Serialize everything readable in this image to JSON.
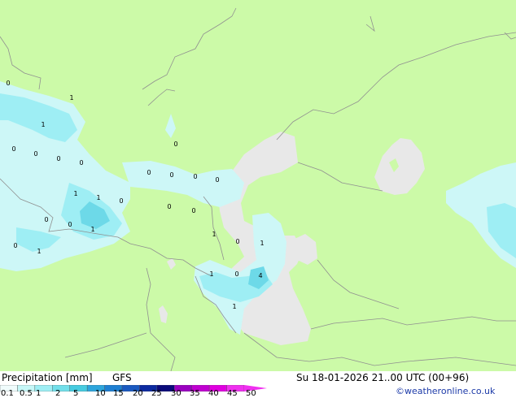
{
  "footer": {
    "title": "Precipitation [mm]",
    "model": "GFS",
    "datetime": "Su 18-01-2026 21..00 UTC (00+96)",
    "credit": "©weatheronline.co.uk"
  },
  "legend": {
    "ticks": [
      "0.1",
      "0.5",
      "1",
      "2",
      "5",
      "10",
      "15",
      "20",
      "25",
      "30",
      "35",
      "40",
      "45",
      "50"
    ],
    "colors": [
      "#f0fcfc",
      "#c6f7f7",
      "#9eeef4",
      "#72dfea",
      "#46cbe0",
      "#2da5dc",
      "#1e7fd2",
      "#1a59c0",
      "#0c2aa0",
      "#0a0a7a",
      "#9a00c0",
      "#c000d0",
      "#e000e0",
      "#f030f0"
    ]
  },
  "map": {
    "land_color": "#ccfaa8",
    "sea_color": "#e8e8e8",
    "precip_light": "#cdf7f7",
    "precip_medium": "#9eeef4",
    "precip_heavy": "#6dd9e8",
    "border_color": "#909090",
    "station_values": [
      "0",
      "1",
      "1",
      "0",
      "0",
      "1",
      "0",
      "1",
      "0",
      "1",
      "1",
      "0",
      "0",
      "0",
      "0",
      "0",
      "0",
      "0",
      "0",
      "1",
      "4",
      "0",
      "1",
      "1",
      "0",
      "0",
      "0",
      "0",
      "1"
    ]
  }
}
